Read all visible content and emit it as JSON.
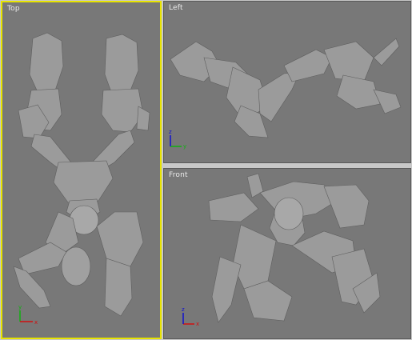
{
  "viewports": {
    "top": {
      "label": "Top"
    },
    "left": {
      "label": "Left"
    },
    "front": {
      "label": "Front"
    }
  },
  "axis_labels": {
    "x": "x",
    "y": "y",
    "z": "z"
  },
  "colors": {
    "viewport_bg": "#787878",
    "active_border": "#e8e400",
    "model_shade": "#9a9a9a",
    "axis_x": "#d01010",
    "axis_y": "#10b010",
    "axis_z": "#1010d0"
  }
}
